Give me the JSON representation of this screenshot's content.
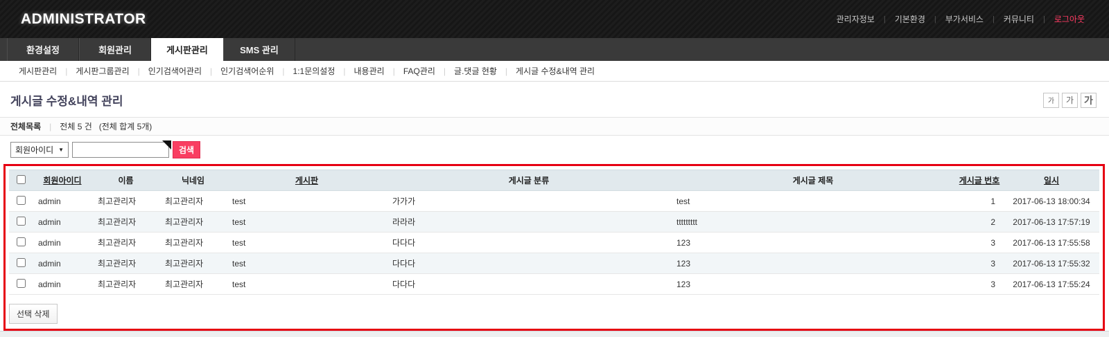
{
  "topbar": {
    "brand": "ADMINISTRATOR",
    "links": [
      "관리자정보",
      "기본환경",
      "부가서비스",
      "커뮤니티",
      "로그아웃"
    ]
  },
  "tabs": [
    "환경설정",
    "회원관리",
    "게시판관리",
    "SMS 관리"
  ],
  "submenu": [
    "게시판관리",
    "게시판그룹관리",
    "인기검색어관리",
    "인기검색어순위",
    "1:1문의설정",
    "내용관리",
    "FAQ관리",
    "글.댓글 현황",
    "게시글 수정&내역 관리"
  ],
  "page": {
    "title": "게시글 수정&내역 관리",
    "font_size_buttons": [
      "가",
      "가",
      "가"
    ],
    "summary": {
      "label": "전체목록",
      "count_text": "전체 5 건",
      "total_text": "(전체 합계 5개)"
    },
    "search": {
      "select_value": "회원아이디",
      "select_arrow": "▼",
      "input_value": "",
      "button_label": "검색"
    }
  },
  "table": {
    "headers": [
      "회원아이디",
      "이름",
      "닉네임",
      "게시판",
      "게시글 분류",
      "게시글 제목",
      "게시글 번호",
      "일시"
    ],
    "sortable_headers": [
      "회원아이디",
      "게시판",
      "게시글 번호",
      "일시"
    ],
    "rows": [
      [
        "admin",
        "최고관리자",
        "최고관리자",
        "test",
        "가가가",
        "test",
        "1",
        "2017-06-13 18:00:34"
      ],
      [
        "admin",
        "최고관리자",
        "최고관리자",
        "test",
        "라라라",
        "ttttttttt",
        "2",
        "2017-06-13 17:57:19"
      ],
      [
        "admin",
        "최고관리자",
        "최고관리자",
        "test",
        "다다다",
        "123",
        "3",
        "2017-06-13 17:55:58"
      ],
      [
        "admin",
        "최고관리자",
        "최고관리자",
        "test",
        "다다다",
        "123",
        "3",
        "2017-06-13 17:55:32"
      ],
      [
        "admin",
        "최고관리자",
        "최고관리자",
        "test",
        "다다다",
        "123",
        "3",
        "2017-06-13 17:55:24"
      ]
    ],
    "delete_button": "선택 삭제"
  },
  "colors": {
    "accent_pink": "#f93e62",
    "annotation_red": "#e60012",
    "logout_red": "#ff3b63",
    "table_header_bg": "#e1e9ed",
    "alt_row_bg": "#f2f6f8",
    "title_navy": "#43435c",
    "topbar_black": "#1a1a1a",
    "tabbar_gray": "#3a3a3a"
  }
}
